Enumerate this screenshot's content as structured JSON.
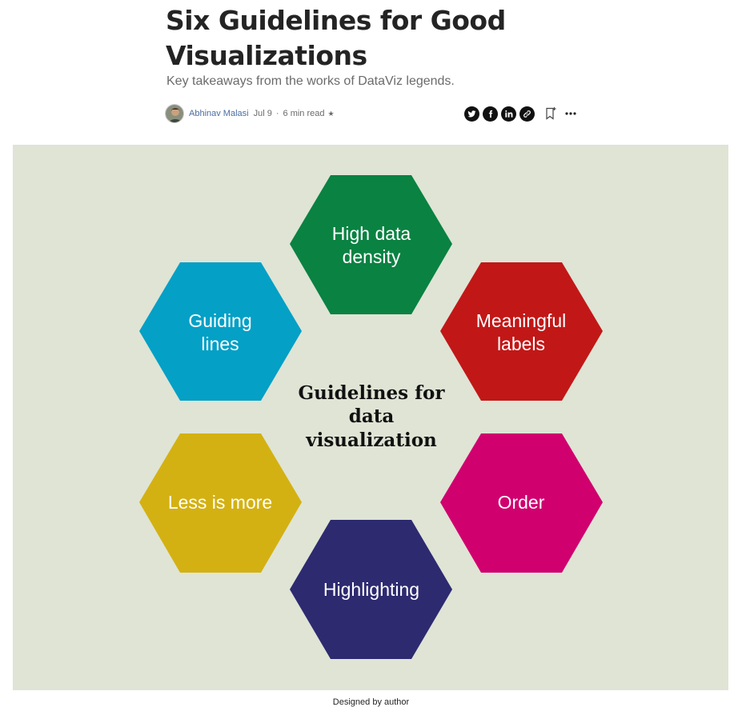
{
  "article": {
    "title": "Six Guidelines for Good Visualizations",
    "subtitle": "Key takeaways from the works of DataViz legends."
  },
  "byline": {
    "author": "Abhinav Malasi",
    "date": "Jul 9",
    "separator": "·",
    "read_time": "6 min read",
    "member_badge": "★"
  },
  "actions": {
    "icons": [
      "twitter-icon",
      "facebook-icon",
      "linkedin-icon",
      "link-icon",
      "bookmark-icon",
      "more-icon"
    ]
  },
  "figure": {
    "background": "#dfe4d5",
    "center_lines": [
      "Guidelines for",
      "data",
      "visualization"
    ],
    "hexagons": [
      {
        "id": "high-data-density",
        "lines": [
          "High data",
          "density"
        ],
        "color": "#0a8242"
      },
      {
        "id": "meaningful-labels",
        "lines": [
          "Meaningful",
          "labels"
        ],
        "color": "#c21717"
      },
      {
        "id": "order",
        "lines": [
          "Order"
        ],
        "color": "#d0006f"
      },
      {
        "id": "highlighting",
        "lines": [
          "Highlighting"
        ],
        "color": "#2d2a70"
      },
      {
        "id": "less-is-more",
        "lines": [
          "Less is more"
        ],
        "color": "#d4b112"
      },
      {
        "id": "guiding-lines",
        "lines": [
          "Guiding",
          "lines"
        ],
        "color": "#04a0c6"
      }
    ],
    "caption": "Designed by author"
  }
}
